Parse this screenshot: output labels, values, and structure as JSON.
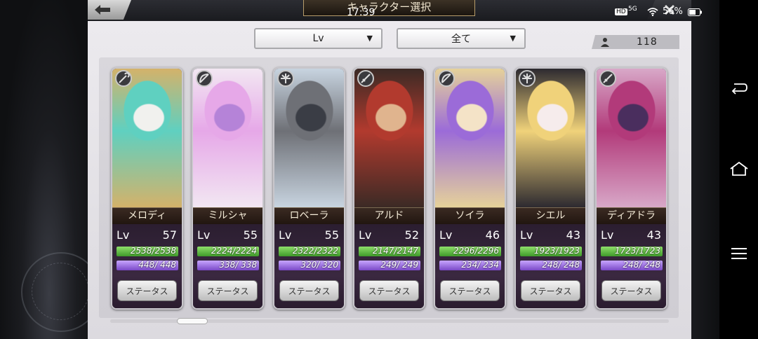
{
  "statusbar": {
    "time": "17:39",
    "hd": "HD",
    "network": "5G",
    "battery": "56%"
  },
  "header": {
    "title": "キャラクター選択",
    "back_icon": "arrow-left-icon",
    "close_icon": "close-icon"
  },
  "filters": {
    "sort_value": "Lv",
    "filter_value": "全て"
  },
  "roster": {
    "count": "118",
    "icon": "person-icon"
  },
  "colors": {
    "hp": "#3f9a2a",
    "mp": "#7a48c7",
    "panel": "#e6e4e8"
  },
  "characters": [
    {
      "name": "メロディ",
      "lv_label": "Lv",
      "level": "57",
      "hp_text": "2538/2538",
      "hp_ratio": 1.0,
      "mp_text": "448/ 448",
      "mp_ratio": 1.0,
      "button": "ステータス",
      "class_icon": "staff-icon",
      "palette": [
        "#5fd0c0",
        "#f1f1ee",
        "#d4b26a"
      ]
    },
    {
      "name": "ミルシャ",
      "lv_label": "Lv",
      "level": "55",
      "hp_text": "2224/2224",
      "hp_ratio": 1.0,
      "mp_text": "338/ 338",
      "mp_ratio": 1.0,
      "button": "ステータス",
      "class_icon": "bow-icon",
      "palette": [
        "#e6a8e8",
        "#b583d8",
        "#f2e7f2"
      ]
    },
    {
      "name": "ロベーラ",
      "lv_label": "Lv",
      "level": "55",
      "hp_text": "2322/2322",
      "hp_ratio": 1.0,
      "mp_text": "320/ 320",
      "mp_ratio": 1.0,
      "button": "ステータス",
      "class_icon": "crossbow-icon",
      "palette": [
        "#6e7076",
        "#3a3d45",
        "#c8d4e0"
      ]
    },
    {
      "name": "アルド",
      "lv_label": "Lv",
      "level": "52",
      "hp_text": "2147/2147",
      "hp_ratio": 1.0,
      "mp_text": "249/ 249",
      "mp_ratio": 1.0,
      "button": "ステータス",
      "class_icon": "sword-icon",
      "palette": [
        "#b23a2e",
        "#e0b48e",
        "#3b2a25"
      ]
    },
    {
      "name": "ソイラ",
      "lv_label": "Lv",
      "level": "46",
      "hp_text": "2296/2296",
      "hp_ratio": 1.0,
      "mp_text": "234/ 234",
      "mp_ratio": 1.0,
      "button": "ステータス",
      "class_icon": "bow-icon",
      "palette": [
        "#9b6bd8",
        "#f4e3c7",
        "#e6d29a"
      ]
    },
    {
      "name": "シエル",
      "lv_label": "Lv",
      "level": "43",
      "hp_text": "1923/1923",
      "hp_ratio": 1.0,
      "mp_text": "248/ 248",
      "mp_ratio": 1.0,
      "button": "ステータス",
      "class_icon": "crossbow-icon",
      "palette": [
        "#f0d27a",
        "#f6ecec",
        "#2d2a30"
      ]
    },
    {
      "name": "ディアドラ",
      "lv_label": "Lv",
      "level": "43",
      "hp_text": "1723/1723",
      "hp_ratio": 1.0,
      "mp_text": "248/ 248",
      "mp_ratio": 1.0,
      "button": "ステータス",
      "class_icon": "sword-icon",
      "palette": [
        "#b23a7a",
        "#4a2e5e",
        "#d8a8c8"
      ]
    }
  ]
}
